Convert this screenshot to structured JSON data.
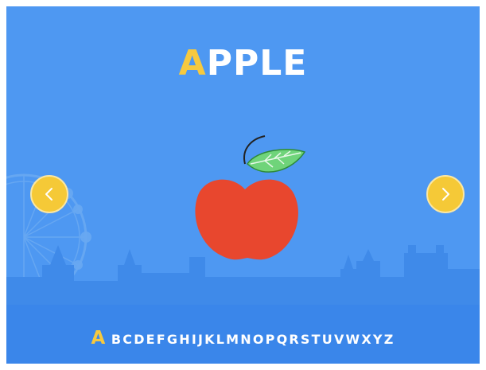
{
  "word": {
    "first_letter": "A",
    "rest": "PPLE"
  },
  "image": {
    "icon": "apple-icon"
  },
  "navigation": {
    "prev_icon": "chevron-left-icon",
    "next_icon": "chevron-right-icon"
  },
  "alphabet": {
    "active": "A",
    "rest": "BCDEFGHIJKLMNOPQRSTUVWXYZ"
  },
  "colors": {
    "background": "#4e98f2",
    "accent": "#f6c93f",
    "apple": "#e8472e",
    "leaf": "#6fd47a"
  }
}
